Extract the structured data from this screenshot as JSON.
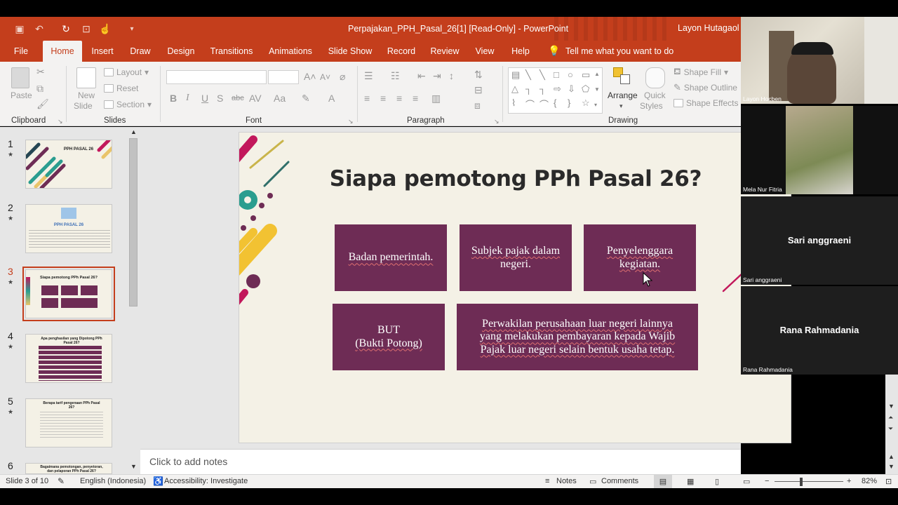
{
  "window": {
    "title": "Perpajakan_PPH_Pasal_26[1] [Read-Only]  -  PowerPoint",
    "user": "Layon Hutagaol"
  },
  "tabs": [
    "File",
    "Home",
    "Insert",
    "Draw",
    "Design",
    "Transitions",
    "Animations",
    "Slide Show",
    "Record",
    "Review",
    "View",
    "Help"
  ],
  "tell_me": "Tell me what you want to do",
  "ribbon": {
    "clipboard": {
      "label": "Clipboard",
      "paste": "Paste"
    },
    "slides": {
      "label": "Slides",
      "new_slide_1": "New",
      "new_slide_2": "Slide",
      "layout": "Layout",
      "reset": "Reset",
      "section": "Section"
    },
    "font": {
      "label": "Font"
    },
    "paragraph": {
      "label": "Paragraph"
    },
    "drawing": {
      "label": "Drawing",
      "arrange": "Arrange",
      "quick_styles_1": "Quick",
      "quick_styles_2": "Styles",
      "shape_fill": "Shape Fill",
      "shape_outline": "Shape Outline",
      "shape_effects": "Shape Effects"
    }
  },
  "thumbnails": [
    {
      "num": "1",
      "title": "PPH PASAL 26"
    },
    {
      "num": "2",
      "title": "PPH PASAL 26"
    },
    {
      "num": "3",
      "title": "Siapa pemotong PPh Pasal 26?"
    },
    {
      "num": "4",
      "title": "Apa penghasilan yang Dipotong PPh Pasal 26?"
    },
    {
      "num": "5",
      "title": "Berapa tarif pengenaan PPh Pasal 26?"
    },
    {
      "num": "6",
      "title": "Bagaimana pemotongan, penyetoran, dan pelaporan PPh Pasal 26?"
    }
  ],
  "slide": {
    "title": "Siapa pemotong PPh Pasal 26?",
    "box1": "Badan pemerintah.",
    "box2_l1": "Subjek pajak dalam",
    "box2_l2": "negeri.",
    "box3_l1": "Penyelenggara",
    "box3_l2": "kegiatan.",
    "box4_l1": "BUT",
    "box4_l2": "(Bukti Potong)",
    "box5_l1": "Perwakilan perusahaan luar negeri lainnya",
    "box5_l2": "yang melakukan pembayaran  kepada Wajib",
    "box5_l3": "Pajak luar negeri selain bentuk usaha tetap."
  },
  "notes_placeholder": "Click to add notes",
  "status": {
    "slide": "Slide 3 of 10",
    "language": "English (Indonesia)",
    "accessibility": "Accessibility: Investigate",
    "notes": "Notes",
    "comments": "Comments",
    "zoom": "82%"
  },
  "participants": [
    {
      "name": "Layon Hocben"
    },
    {
      "name": "Mela Nur Fitria"
    },
    {
      "name": "Sari anggraeni"
    },
    {
      "name": "Rana Rahmadania"
    }
  ],
  "colors": {
    "accent": "#c43e1c",
    "box": "#6e2c55",
    "slide_bg": "#f4f1e6"
  }
}
